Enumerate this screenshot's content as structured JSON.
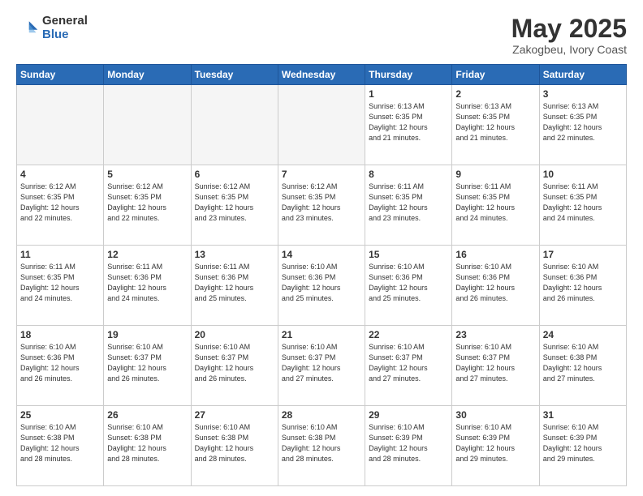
{
  "header": {
    "logo_general": "General",
    "logo_blue": "Blue",
    "title": "May 2025",
    "subtitle": "Zakogbeu, Ivory Coast"
  },
  "weekdays": [
    "Sunday",
    "Monday",
    "Tuesday",
    "Wednesday",
    "Thursday",
    "Friday",
    "Saturday"
  ],
  "weeks": [
    [
      {
        "day": "",
        "info": ""
      },
      {
        "day": "",
        "info": ""
      },
      {
        "day": "",
        "info": ""
      },
      {
        "day": "",
        "info": ""
      },
      {
        "day": "1",
        "info": "Sunrise: 6:13 AM\nSunset: 6:35 PM\nDaylight: 12 hours\nand 21 minutes."
      },
      {
        "day": "2",
        "info": "Sunrise: 6:13 AM\nSunset: 6:35 PM\nDaylight: 12 hours\nand 21 minutes."
      },
      {
        "day": "3",
        "info": "Sunrise: 6:13 AM\nSunset: 6:35 PM\nDaylight: 12 hours\nand 22 minutes."
      }
    ],
    [
      {
        "day": "4",
        "info": "Sunrise: 6:12 AM\nSunset: 6:35 PM\nDaylight: 12 hours\nand 22 minutes."
      },
      {
        "day": "5",
        "info": "Sunrise: 6:12 AM\nSunset: 6:35 PM\nDaylight: 12 hours\nand 22 minutes."
      },
      {
        "day": "6",
        "info": "Sunrise: 6:12 AM\nSunset: 6:35 PM\nDaylight: 12 hours\nand 23 minutes."
      },
      {
        "day": "7",
        "info": "Sunrise: 6:12 AM\nSunset: 6:35 PM\nDaylight: 12 hours\nand 23 minutes."
      },
      {
        "day": "8",
        "info": "Sunrise: 6:11 AM\nSunset: 6:35 PM\nDaylight: 12 hours\nand 23 minutes."
      },
      {
        "day": "9",
        "info": "Sunrise: 6:11 AM\nSunset: 6:35 PM\nDaylight: 12 hours\nand 24 minutes."
      },
      {
        "day": "10",
        "info": "Sunrise: 6:11 AM\nSunset: 6:35 PM\nDaylight: 12 hours\nand 24 minutes."
      }
    ],
    [
      {
        "day": "11",
        "info": "Sunrise: 6:11 AM\nSunset: 6:35 PM\nDaylight: 12 hours\nand 24 minutes."
      },
      {
        "day": "12",
        "info": "Sunrise: 6:11 AM\nSunset: 6:36 PM\nDaylight: 12 hours\nand 24 minutes."
      },
      {
        "day": "13",
        "info": "Sunrise: 6:11 AM\nSunset: 6:36 PM\nDaylight: 12 hours\nand 25 minutes."
      },
      {
        "day": "14",
        "info": "Sunrise: 6:10 AM\nSunset: 6:36 PM\nDaylight: 12 hours\nand 25 minutes."
      },
      {
        "day": "15",
        "info": "Sunrise: 6:10 AM\nSunset: 6:36 PM\nDaylight: 12 hours\nand 25 minutes."
      },
      {
        "day": "16",
        "info": "Sunrise: 6:10 AM\nSunset: 6:36 PM\nDaylight: 12 hours\nand 26 minutes."
      },
      {
        "day": "17",
        "info": "Sunrise: 6:10 AM\nSunset: 6:36 PM\nDaylight: 12 hours\nand 26 minutes."
      }
    ],
    [
      {
        "day": "18",
        "info": "Sunrise: 6:10 AM\nSunset: 6:36 PM\nDaylight: 12 hours\nand 26 minutes."
      },
      {
        "day": "19",
        "info": "Sunrise: 6:10 AM\nSunset: 6:37 PM\nDaylight: 12 hours\nand 26 minutes."
      },
      {
        "day": "20",
        "info": "Sunrise: 6:10 AM\nSunset: 6:37 PM\nDaylight: 12 hours\nand 26 minutes."
      },
      {
        "day": "21",
        "info": "Sunrise: 6:10 AM\nSunset: 6:37 PM\nDaylight: 12 hours\nand 27 minutes."
      },
      {
        "day": "22",
        "info": "Sunrise: 6:10 AM\nSunset: 6:37 PM\nDaylight: 12 hours\nand 27 minutes."
      },
      {
        "day": "23",
        "info": "Sunrise: 6:10 AM\nSunset: 6:37 PM\nDaylight: 12 hours\nand 27 minutes."
      },
      {
        "day": "24",
        "info": "Sunrise: 6:10 AM\nSunset: 6:38 PM\nDaylight: 12 hours\nand 27 minutes."
      }
    ],
    [
      {
        "day": "25",
        "info": "Sunrise: 6:10 AM\nSunset: 6:38 PM\nDaylight: 12 hours\nand 28 minutes."
      },
      {
        "day": "26",
        "info": "Sunrise: 6:10 AM\nSunset: 6:38 PM\nDaylight: 12 hours\nand 28 minutes."
      },
      {
        "day": "27",
        "info": "Sunrise: 6:10 AM\nSunset: 6:38 PM\nDaylight: 12 hours\nand 28 minutes."
      },
      {
        "day": "28",
        "info": "Sunrise: 6:10 AM\nSunset: 6:38 PM\nDaylight: 12 hours\nand 28 minutes."
      },
      {
        "day": "29",
        "info": "Sunrise: 6:10 AM\nSunset: 6:39 PM\nDaylight: 12 hours\nand 28 minutes."
      },
      {
        "day": "30",
        "info": "Sunrise: 6:10 AM\nSunset: 6:39 PM\nDaylight: 12 hours\nand 29 minutes."
      },
      {
        "day": "31",
        "info": "Sunrise: 6:10 AM\nSunset: 6:39 PM\nDaylight: 12 hours\nand 29 minutes."
      }
    ]
  ]
}
